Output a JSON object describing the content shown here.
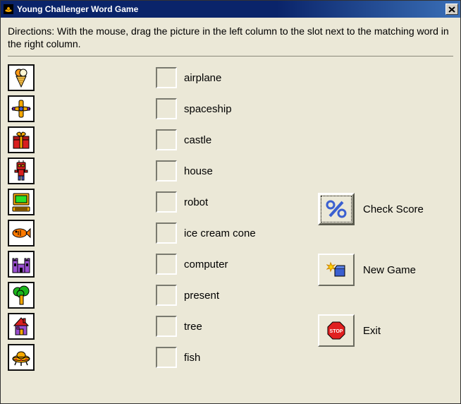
{
  "window": {
    "title": "Young Challenger Word Game"
  },
  "directions": "Directions: With the mouse, drag the picture in the left column to the slot next to the matching word in the right column.",
  "pictures": [
    {
      "icon": "ice-cream-cone"
    },
    {
      "icon": "airplane"
    },
    {
      "icon": "present"
    },
    {
      "icon": "robot"
    },
    {
      "icon": "computer"
    },
    {
      "icon": "fish"
    },
    {
      "icon": "castle"
    },
    {
      "icon": "tree"
    },
    {
      "icon": "house"
    },
    {
      "icon": "spaceship"
    }
  ],
  "words": [
    "airplane",
    "spaceship",
    "castle",
    "house",
    "robot",
    "ice cream cone",
    "computer",
    "present",
    "tree",
    "fish"
  ],
  "buttons": {
    "check_score": "Check Score",
    "new_game": "New Game",
    "exit": "Exit"
  }
}
